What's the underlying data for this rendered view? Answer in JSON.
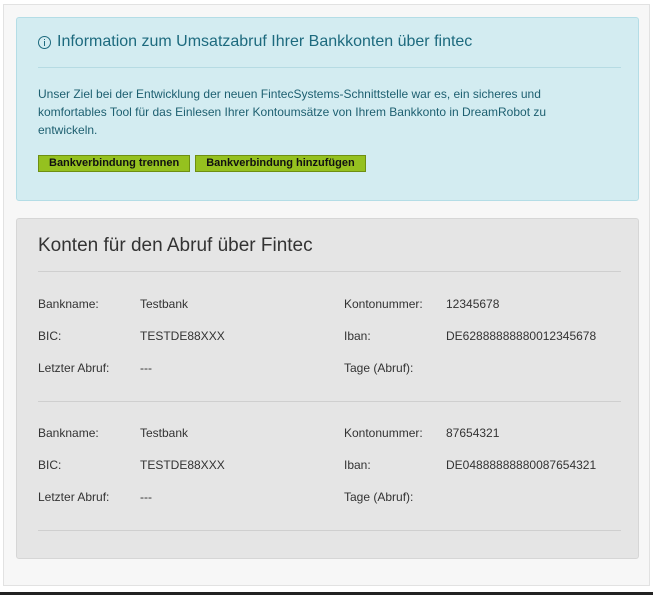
{
  "info": {
    "icon": "info-circle-icon",
    "title": "Information zum Umsatzabruf Ihrer Bankkonten über fintec",
    "text": "Unser Ziel bei der Entwicklung der neuen FintecSystems-Schnittstelle war es, ein sicheres und komfortables Tool für das Einlesen Ihrer Kontoumsätze von Ihrem Bankkonto in DreamRobot zu entwickeln.",
    "buttons": {
      "disconnect": "Bankverbindung trennen",
      "add": "Bankverbindung hinzufügen"
    }
  },
  "accounts": {
    "title": "Konten für den Abruf über Fintec",
    "labels": {
      "bankname": "Bankname:",
      "bic": "BIC:",
      "last_fetch": "Letzter Abruf:",
      "account_number": "Kontonummer:",
      "iban": "Iban:",
      "days": "Tage (Abruf):"
    },
    "items": [
      {
        "bankname": "Testbank",
        "bic": "TESTDE88XXX",
        "last_fetch": "---",
        "account_number": "12345678",
        "iban": "DE62888888880012345678",
        "days": ""
      },
      {
        "bankname": "Testbank",
        "bic": "TESTDE88XXX",
        "last_fetch": "---",
        "account_number": "87654321",
        "iban": "DE04888888880087654321",
        "days": ""
      }
    ]
  },
  "colors": {
    "info_bg": "#d3ecf1",
    "info_text": "#1d6a7e",
    "button_bg": "#95c11f",
    "accounts_bg": "#e5e5e5"
  }
}
